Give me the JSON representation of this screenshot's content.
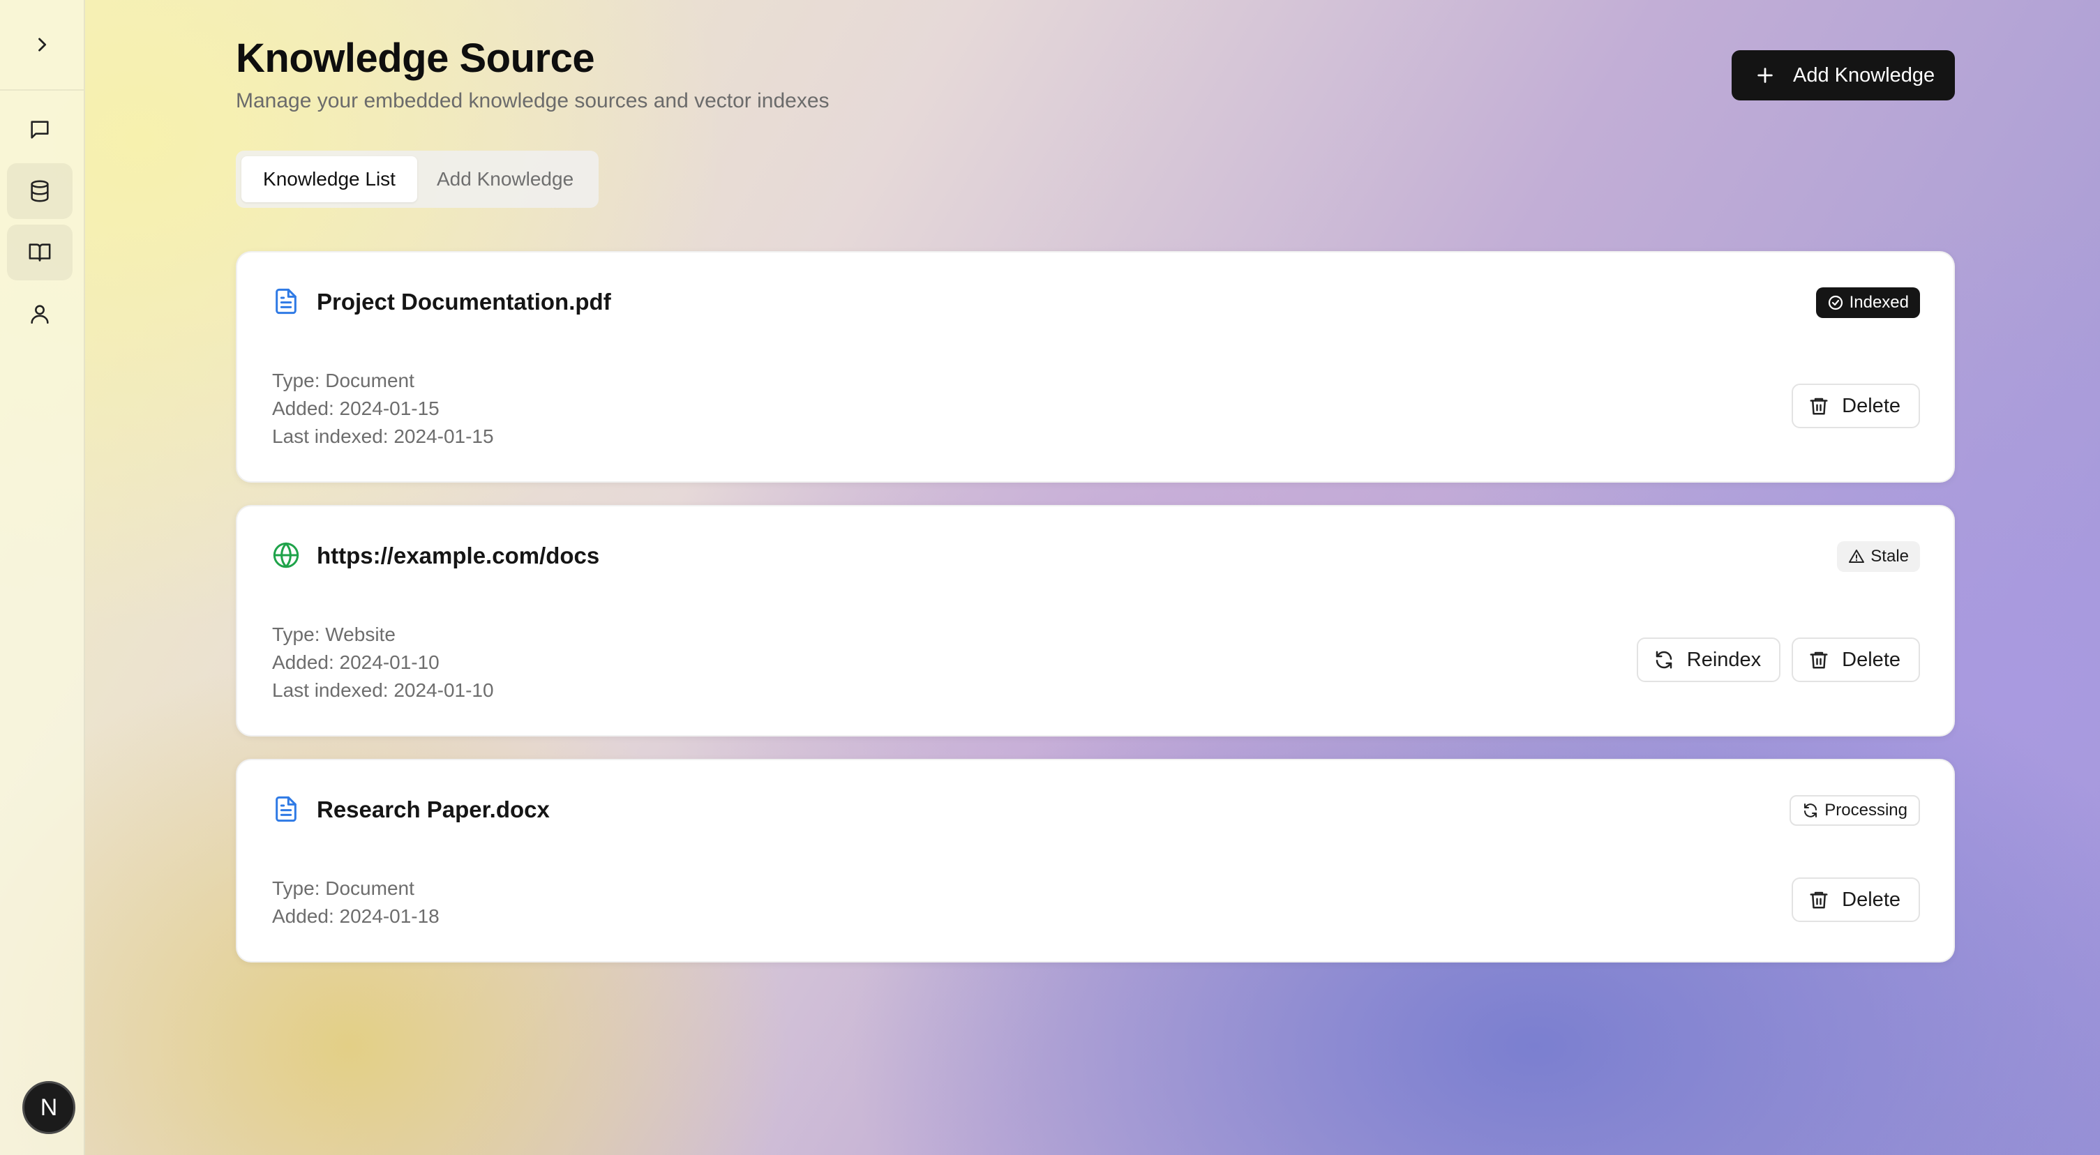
{
  "sidebar": {
    "items": [
      {
        "icon": "chat-icon"
      },
      {
        "icon": "database-icon"
      },
      {
        "icon": "book-icon"
      },
      {
        "icon": "user-icon"
      }
    ],
    "avatar_initial": "N"
  },
  "header": {
    "title": "Knowledge Source",
    "subtitle": "Manage your embedded knowledge sources and vector indexes",
    "add_button_label": "Add Knowledge"
  },
  "tabs": [
    {
      "label": "Knowledge List",
      "active": true
    },
    {
      "label": "Add Knowledge",
      "active": false
    }
  ],
  "sources": [
    {
      "name": "Project Documentation.pdf",
      "icon": "document-icon",
      "status": "Indexed",
      "type": "Type: Document",
      "added": "Added: 2024-01-15",
      "last_indexed": "Last indexed: 2024-01-15",
      "actions": {
        "delete": "Delete"
      }
    },
    {
      "name": "https://example.com/docs",
      "icon": "globe-icon",
      "status": "Stale",
      "type": "Type: Website",
      "added": "Added: 2024-01-10",
      "last_indexed": "Last indexed: 2024-01-10",
      "actions": {
        "reindex": "Reindex",
        "delete": "Delete"
      }
    },
    {
      "name": "Research Paper.docx",
      "icon": "document-icon",
      "status": "Processing",
      "type": "Type: Document",
      "added": "Added: 2024-01-18",
      "actions": {
        "delete": "Delete"
      }
    }
  ],
  "colors": {
    "document_icon": "#2f7ae5",
    "globe_icon": "#1fa34a",
    "primary_button": "#141414"
  }
}
